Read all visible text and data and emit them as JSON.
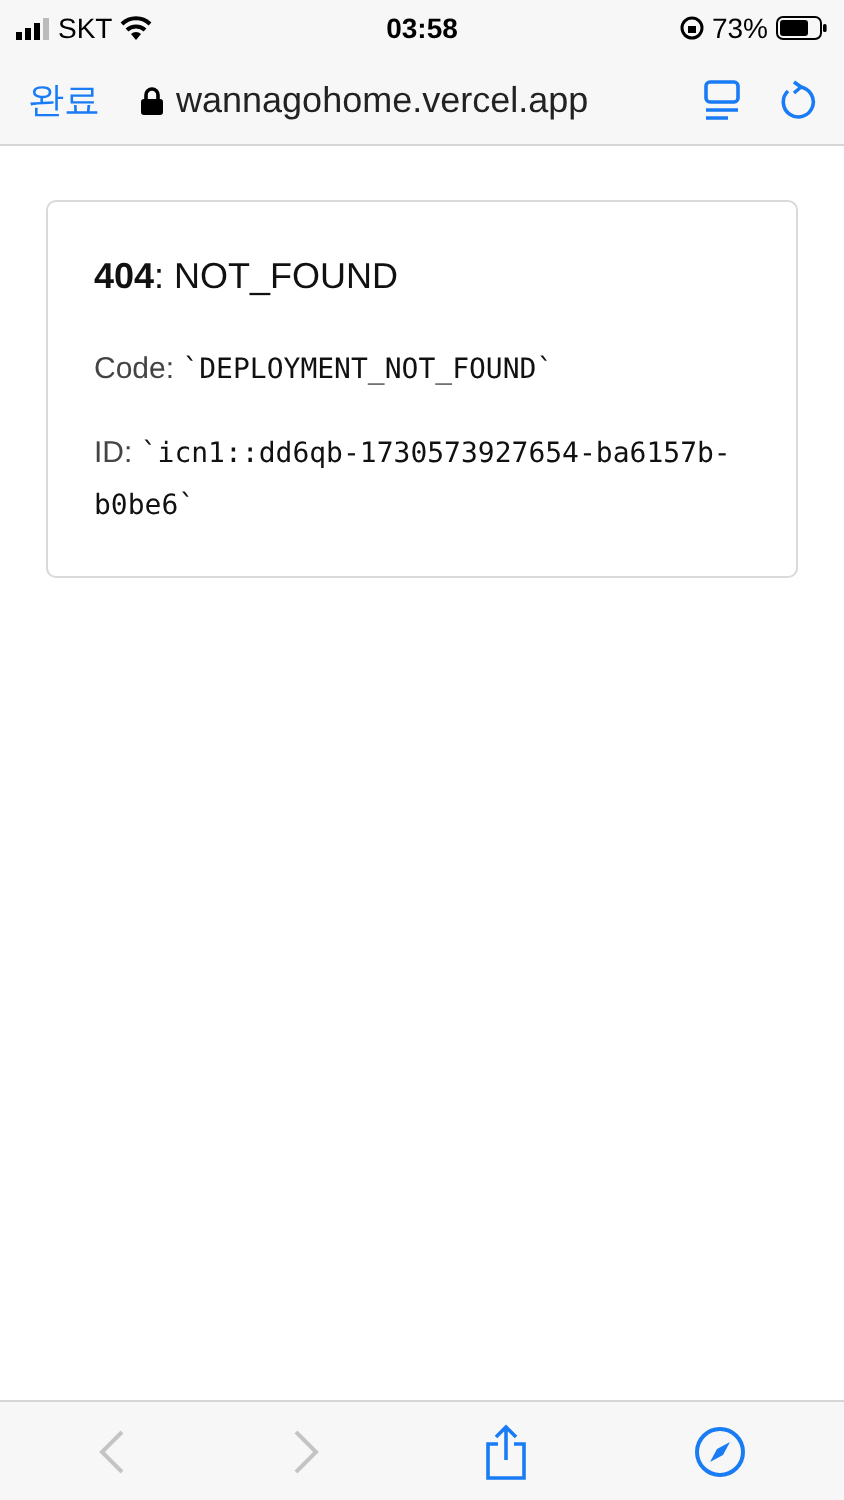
{
  "status_bar": {
    "carrier": "SKT",
    "time": "03:58",
    "battery": "73%"
  },
  "browser_bar": {
    "done": "완료",
    "url": "wannagohome.vercel.app"
  },
  "error": {
    "code_number": "404",
    "title": ": NOT_FOUND",
    "lines": [
      {
        "label": "Code: ",
        "value": "`DEPLOYMENT_NOT_FOUND`"
      },
      {
        "label": "ID: ",
        "value": "`icn1::dd6qb-1730573927654-ba6157b-b0be6`"
      }
    ]
  },
  "toolbar": {
    "back": {
      "disabled": true
    },
    "forward": {
      "disabled": true
    }
  }
}
